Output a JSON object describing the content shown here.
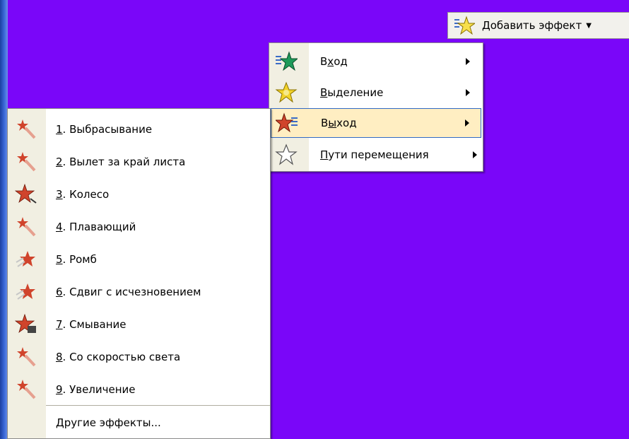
{
  "toolbar": {
    "add_effect_label": "Добавить эффект",
    "add_effect_icon": "add-effect-star-icon"
  },
  "effect_categories": [
    {
      "prefix": "В",
      "accel": "х",
      "rest": "од",
      "label": "Вход",
      "icon": "entrance-green-star-icon",
      "has_submenu": true
    },
    {
      "prefix": "",
      "accel": "В",
      "rest": "ыделение",
      "label": "Выделение",
      "icon": "emphasis-yellow-star-icon",
      "has_submenu": true
    },
    {
      "prefix": "В",
      "accel": "ы",
      "rest": "ход",
      "label": "Выход",
      "icon": "exit-red-star-icon",
      "has_submenu": true,
      "active": true
    },
    {
      "prefix": "",
      "accel": "П",
      "rest": "ути перемещения",
      "label": "Пути перемещения",
      "icon": "motion-path-outline-star-icon",
      "has_submenu": true
    }
  ],
  "exit_effects": [
    {
      "num": "1",
      "label": ". Выбрасывание"
    },
    {
      "num": "2",
      "label": ". Вылет за край листа"
    },
    {
      "num": "3",
      "label": ". Колесо"
    },
    {
      "num": "4",
      "label": ". Плавающий"
    },
    {
      "num": "5",
      "label": ". Ромб"
    },
    {
      "num": "6",
      "label": ". Сдвиг с исчезновением"
    },
    {
      "num": "7",
      "label": ". Смывание"
    },
    {
      "num": "8",
      "label": ". Со скоростью света"
    },
    {
      "num": "9",
      "label": ". Увеличение"
    }
  ],
  "more_effects": {
    "accel": "Д",
    "rest": "ругие эффекты..."
  },
  "colors": {
    "background": "#7a06f9",
    "menu_strip": "#f1efe2",
    "highlight_fill": "#ffeec2",
    "highlight_border": "#316ac5",
    "exit_star": "#d0442c",
    "entrance_star": "#1e9a5a",
    "emphasis_star": "#f2d22a"
  }
}
